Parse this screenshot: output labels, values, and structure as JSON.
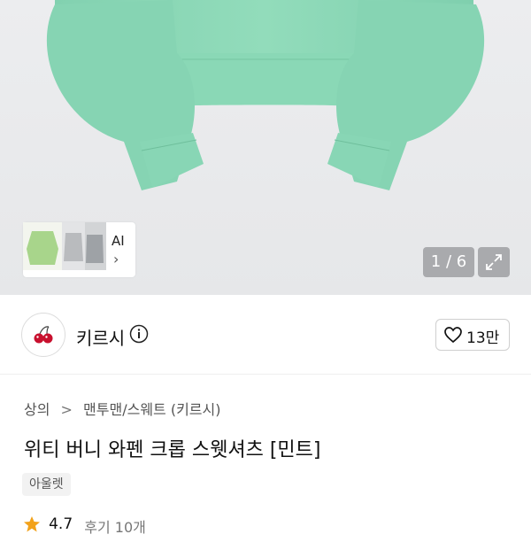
{
  "gallery": {
    "page_indicator": "1 / 6",
    "ai_label": "AI",
    "ai_chevron": "›",
    "product_color": "#8fd8b8",
    "background_color": "#e9eaec"
  },
  "brand": {
    "name": "키르시",
    "logo_icon": "cherry-icon",
    "info_icon": "info-icon",
    "like_count": "13만"
  },
  "breadcrumb": {
    "items": [
      "상의",
      "맨투맨/스웨트 (키르시)"
    ],
    "separator": ">"
  },
  "product": {
    "title": "위티 버니 와펜 크롭 스웻셔츠 [민트]",
    "tag": "아울렛",
    "rating": "4.7",
    "review_label": "후기 10개"
  }
}
